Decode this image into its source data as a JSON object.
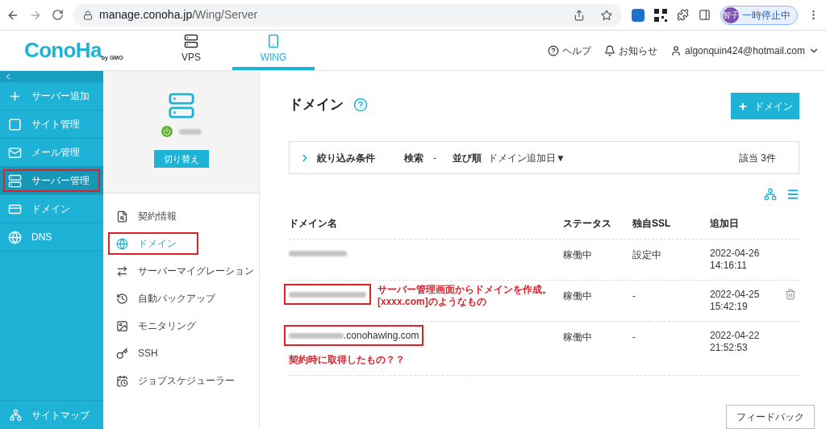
{
  "browser": {
    "url_host": "manage.conoha.jp",
    "url_path": "/Wing/Server",
    "avatar_text": "智子",
    "profile_status": "一時停止中"
  },
  "header": {
    "logo": {
      "text": "ConoHa",
      "sub": "by GMO"
    },
    "tabs": [
      {
        "label": "VPS",
        "selected": false
      },
      {
        "label": "WING",
        "selected": true
      }
    ],
    "links": [
      {
        "label": "ヘルプ",
        "dropdown": false
      },
      {
        "label": "お知らせ",
        "dropdown": false
      },
      {
        "label": "algonquin424@hotmail.com",
        "dropdown": true
      }
    ]
  },
  "sidebar": {
    "items": [
      {
        "label": "サーバー追加",
        "selected": false,
        "highlighted": false
      },
      {
        "label": "サイト管理",
        "selected": false,
        "highlighted": false
      },
      {
        "label": "メール管理",
        "selected": false,
        "highlighted": false
      },
      {
        "label": "サーバー管理",
        "selected": true,
        "highlighted": true
      },
      {
        "label": "ドメイン",
        "selected": false,
        "highlighted": false
      },
      {
        "label": "DNS",
        "selected": false,
        "highlighted": false
      }
    ],
    "footer": {
      "label": "サイトマップ"
    }
  },
  "server_panel": {
    "running": true,
    "switch_button": "切り替え"
  },
  "submenu": [
    {
      "label": "契約情報",
      "selected": false,
      "highlighted": false
    },
    {
      "label": "ドメイン",
      "selected": true,
      "highlighted": true
    },
    {
      "label": "サーバーマイグレーション",
      "selected": false,
      "highlighted": false
    },
    {
      "label": "自動バックアップ",
      "selected": false,
      "highlighted": false
    },
    {
      "label": "モニタリング",
      "selected": false,
      "highlighted": false
    },
    {
      "label": "SSH",
      "selected": false,
      "highlighted": false
    },
    {
      "label": "ジョブスケジューラー",
      "selected": false,
      "highlighted": false
    }
  ],
  "main": {
    "title": "ドメイン",
    "add_button": "ドメイン",
    "filter": {
      "label": "絞り込み条件",
      "search_label": "検索",
      "search_value": "-",
      "sort_label": "並び順",
      "sort_value": "ドメイン追加日▼",
      "count": "該当 3件"
    },
    "table": {
      "columns": [
        "ドメイン名",
        "ステータス",
        "独自SSL",
        "追加日"
      ],
      "rows": [
        {
          "status": "稼働中",
          "ssl": "設定中",
          "date": "2022-04-26",
          "time": "14:16:11",
          "highlighted": false,
          "deletable": false
        },
        {
          "status": "稼働中",
          "ssl": "-",
          "date": "2022-04-25",
          "time": "15:42:19",
          "highlighted": true,
          "deletable": true,
          "note": {
            "kind": "beside",
            "lines": [
              "サーバー管理画面からドメインを作成。",
              "[xxxx.com]のようなもの"
            ]
          }
        },
        {
          "name_suffix": ".conohawing.com",
          "status": "稼働中",
          "ssl": "-",
          "date": "2022-04-22",
          "time": "21:52:53",
          "highlighted": true,
          "deletable": false,
          "note": {
            "kind": "below",
            "lines": [
              "契約時に取得したもの？？"
            ]
          }
        }
      ]
    }
  },
  "feedback_button": "フィードバック"
}
